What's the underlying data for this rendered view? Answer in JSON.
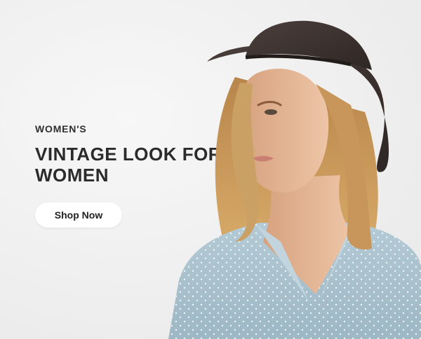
{
  "banner": {
    "eyebrow": "WOMEN'S",
    "headline": "VINTAGE LOOK FOR WOMEN",
    "cta_label": "Shop Now"
  },
  "colors": {
    "background": "#efefef",
    "text": "#2b2b2b",
    "button_background": "#ffffff",
    "hat": "#3f3533",
    "hair": "#c9944f",
    "skin": "#e4b896",
    "shirt": "#a9c3cf"
  },
  "image": {
    "subject": "woman-in-hat-photo"
  }
}
